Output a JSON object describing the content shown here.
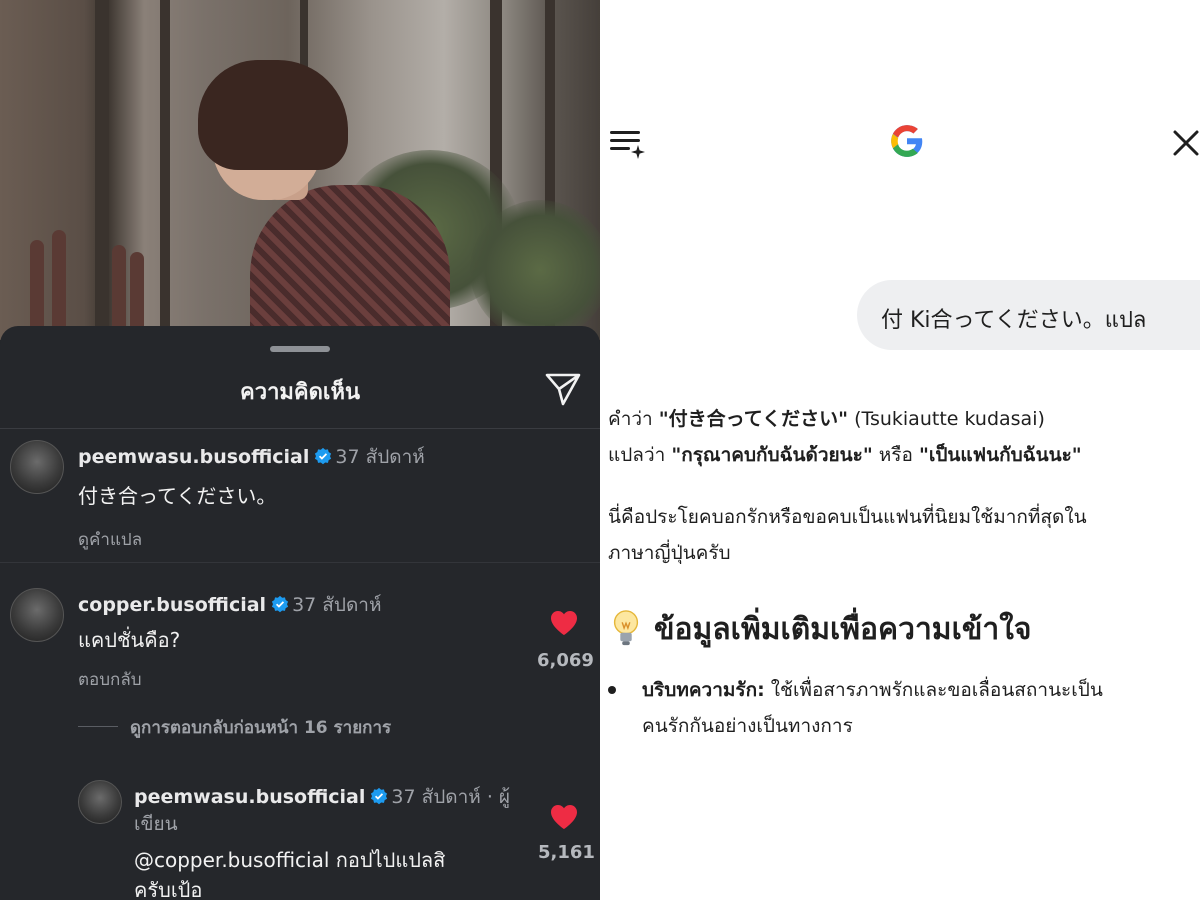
{
  "comments_panel": {
    "title": "ความคิดเห็น",
    "comments": [
      {
        "username": "peemwasu.busofficial",
        "time": "37 สัปดาห์",
        "text": "付き合ってください。",
        "action": "ดูคำแปล"
      },
      {
        "username": "copper.busofficial",
        "time": "37 สัปดาห์",
        "text": "แคปชั่นคือ?",
        "action": "ตอบกลับ",
        "likes": "6,069"
      }
    ],
    "view_previous_replies": "ดูการตอบกลับก่อนหน้า 16 รายการ",
    "reply": {
      "username": "peemwasu.busofficial",
      "time_line1": "37 สัปดาห์ · ผู้",
      "time_line2": "เขียน",
      "text_line1": "@copper.busofficial กอปไปแปลสิ",
      "text_line2": "ครับเป้อ",
      "likes": "5,161"
    },
    "colors": {
      "background": "#25272b",
      "heart": "#ee2c44",
      "verified": "#1d9bf0"
    }
  },
  "assistant_panel": {
    "user_prompt": "付 Ki合ってください。แปล",
    "answer": {
      "line1_prefix": "คำว่า ",
      "line1_bold": "\"付き合ってください\"",
      "line1_suffix": " (Tsukiautte kudasai)",
      "line2_prefix": "แปลว่า ",
      "line2_bold1": "\"กรุณาคบกับฉันด้วยนะ\"",
      "line2_mid": " หรือ ",
      "line2_bold2": "\"เป็นแฟนกับฉันนะ\"",
      "para2_line1": "นี่คือประโยคบอกรักหรือขอคบเป็นแฟนที่นิยมใช้มากที่สุดใน",
      "para2_line2": "ภาษาญี่ปุ่นครับ"
    },
    "section_title": "ข้อมูลเพิ่มเติมเพื่อความเข้าใจ",
    "bullet": {
      "label": "บริบทความรัก:",
      "text_line1": " ใช้เพื่อสารภาพรักและขอเลื่อนสถานะเป็น",
      "text_line2": "คนรักกันอย่างเป็นทางการ"
    },
    "icons": [
      "menu-sparkle-icon",
      "google-g-logo",
      "close-icon",
      "lightbulb-icon"
    ]
  }
}
